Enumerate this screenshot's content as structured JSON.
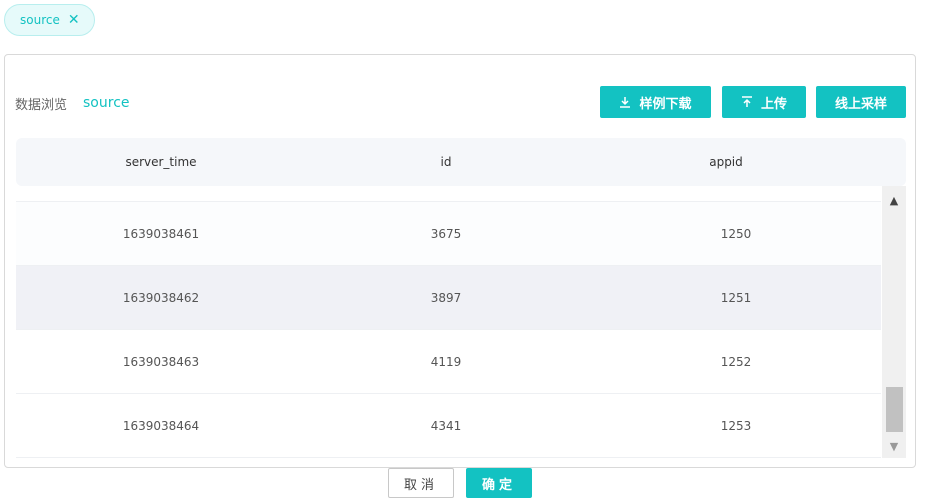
{
  "tag": {
    "label": "source",
    "close": "✕"
  },
  "panel": {
    "crumb_label": "数据浏览",
    "crumb_source": "source",
    "buttons": {
      "download": "样例下载",
      "upload": "上传",
      "sample": "线上采样"
    }
  },
  "table": {
    "columns": [
      "server_time",
      "id",
      "appid"
    ],
    "rows": [
      [
        "1639038461",
        "3675",
        "1250"
      ],
      [
        "1639038462",
        "3897",
        "1251"
      ],
      [
        "1639038463",
        "4119",
        "1252"
      ],
      [
        "1639038464",
        "4341",
        "1253"
      ]
    ]
  },
  "footer": {
    "cancel": "取消",
    "ok": "确定"
  },
  "colors": {
    "accent": "#13c2c2"
  }
}
